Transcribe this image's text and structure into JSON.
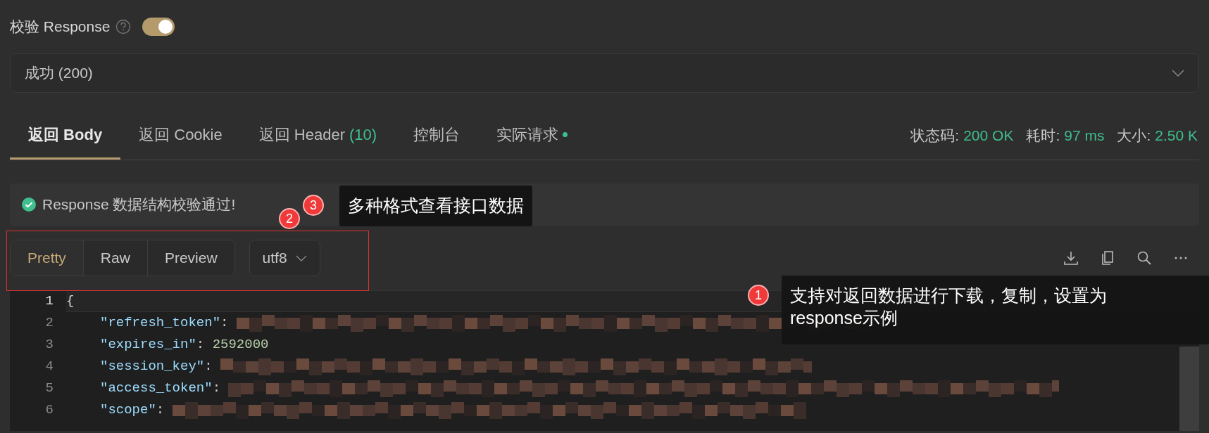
{
  "validate": {
    "label": "校验 Response",
    "on": true
  },
  "response_select": {
    "value": "成功 (200)"
  },
  "tabs": [
    {
      "label": "返回 Body",
      "selected": true
    },
    {
      "label": "返回 Cookie",
      "selected": false
    },
    {
      "label": "返回 Header",
      "count": "(10)",
      "selected": false
    },
    {
      "label": "控制台",
      "selected": false
    },
    {
      "label": "实际请求",
      "dot": true,
      "selected": false
    }
  ],
  "stats": [
    {
      "label": "状态码:",
      "value": "200 OK"
    },
    {
      "label": "耗时:",
      "value": "97 ms"
    },
    {
      "label": "大小:",
      "value": "2.50 K"
    }
  ],
  "validation_message": "Response 数据结构校验通过!",
  "view_modes": [
    {
      "label": "Pretty",
      "selected": true
    },
    {
      "label": "Raw",
      "selected": false
    },
    {
      "label": "Preview",
      "selected": false
    }
  ],
  "encoding": "utf8",
  "code_lines": [
    {
      "number": "1",
      "parts": [
        {
          "kind": "punct",
          "text": "{"
        }
      ]
    },
    {
      "number": "2",
      "parts": [
        {
          "kind": "key",
          "text": "\"refresh_token\""
        },
        {
          "kind": "punct",
          "text": ": "
        },
        {
          "kind": "redacted"
        }
      ]
    },
    {
      "number": "3",
      "parts": [
        {
          "kind": "key",
          "text": "\"expires_in\""
        },
        {
          "kind": "punct",
          "text": ": "
        },
        {
          "kind": "number",
          "text": "2592000"
        }
      ]
    },
    {
      "number": "4",
      "parts": [
        {
          "kind": "key",
          "text": "\"session_key\""
        },
        {
          "kind": "punct",
          "text": ": "
        },
        {
          "kind": "redacted"
        }
      ]
    },
    {
      "number": "5",
      "parts": [
        {
          "kind": "key",
          "text": "\"access_token\""
        },
        {
          "kind": "punct",
          "text": ": "
        },
        {
          "kind": "redacted"
        }
      ]
    },
    {
      "number": "6",
      "parts": [
        {
          "kind": "key",
          "text": "\"scope\""
        },
        {
          "kind": "punct",
          "text": ": "
        },
        {
          "kind": "redacted"
        }
      ]
    }
  ],
  "annotations": [
    {
      "number": "1",
      "text": "支持对返回数据进行下载，复制，设置为response示例"
    },
    {
      "number": "2"
    },
    {
      "number": "3",
      "text": "多种格式查看接口数据"
    }
  ]
}
